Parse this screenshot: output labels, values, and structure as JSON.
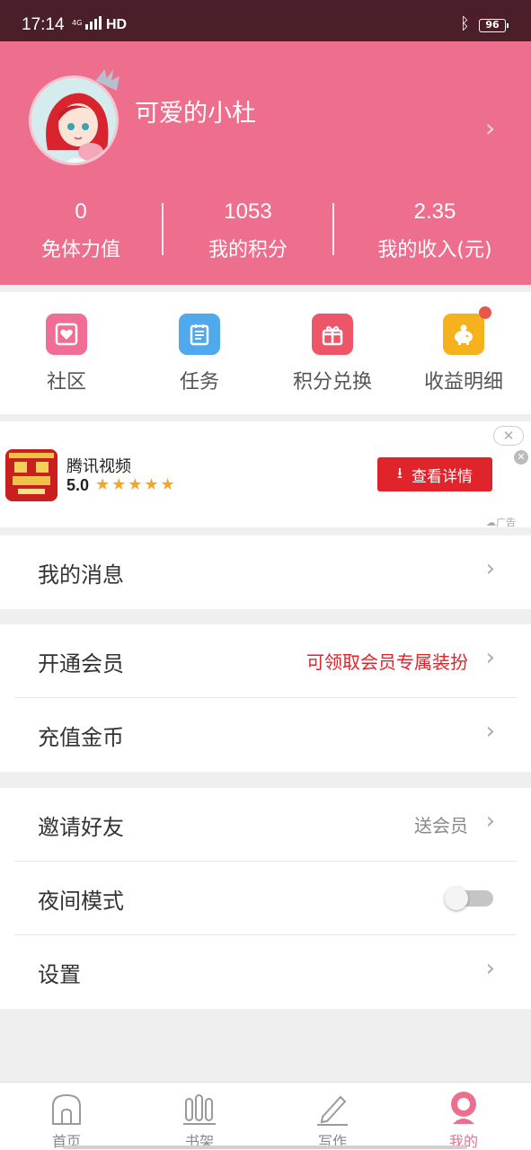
{
  "status_bar": {
    "time": "17:14",
    "network": "4G",
    "hd": "HD",
    "battery": "96"
  },
  "profile": {
    "username": "可爱的小杜",
    "stats": [
      {
        "value": "0",
        "label": "免体力值"
      },
      {
        "value": "1053",
        "label": "我的积分"
      },
      {
        "value": "2.35",
        "label": "我的收入(元)"
      }
    ]
  },
  "quick_actions": [
    {
      "label": "社区",
      "icon": "community-icon",
      "color": "#f06e95"
    },
    {
      "label": "任务",
      "icon": "task-icon",
      "color": "#4fa9ec"
    },
    {
      "label": "积分兑换",
      "icon": "gift-icon",
      "color": "#ec5668"
    },
    {
      "label": "收益明细",
      "icon": "piggy-bank-icon",
      "color": "#f6b21c"
    }
  ],
  "ad": {
    "title": "腾讯视频",
    "score": "5.0",
    "stars": "★★★★★",
    "button": "查看详情",
    "close": "✕",
    "tag": "广告"
  },
  "menu": {
    "messages": {
      "label": "我的消息"
    },
    "vip": {
      "label": "开通会员",
      "extra": "可领取会员专属装扮",
      "extra_color": "#e0242b"
    },
    "recharge": {
      "label": "充值金币"
    },
    "invite": {
      "label": "邀请好友",
      "extra": "送会员"
    },
    "night": {
      "label": "夜间模式",
      "enabled": false
    },
    "settings": {
      "label": "设置"
    }
  },
  "tabbar": [
    {
      "label": "首页",
      "icon": "home-icon"
    },
    {
      "label": "书架",
      "icon": "bookshelf-icon"
    },
    {
      "label": "写作",
      "icon": "pen-icon"
    },
    {
      "label": "我的",
      "icon": "profile-icon",
      "active": true
    }
  ],
  "colors": {
    "brand_pink": "#ee6e8d",
    "status_bar": "#4a1f2a"
  }
}
